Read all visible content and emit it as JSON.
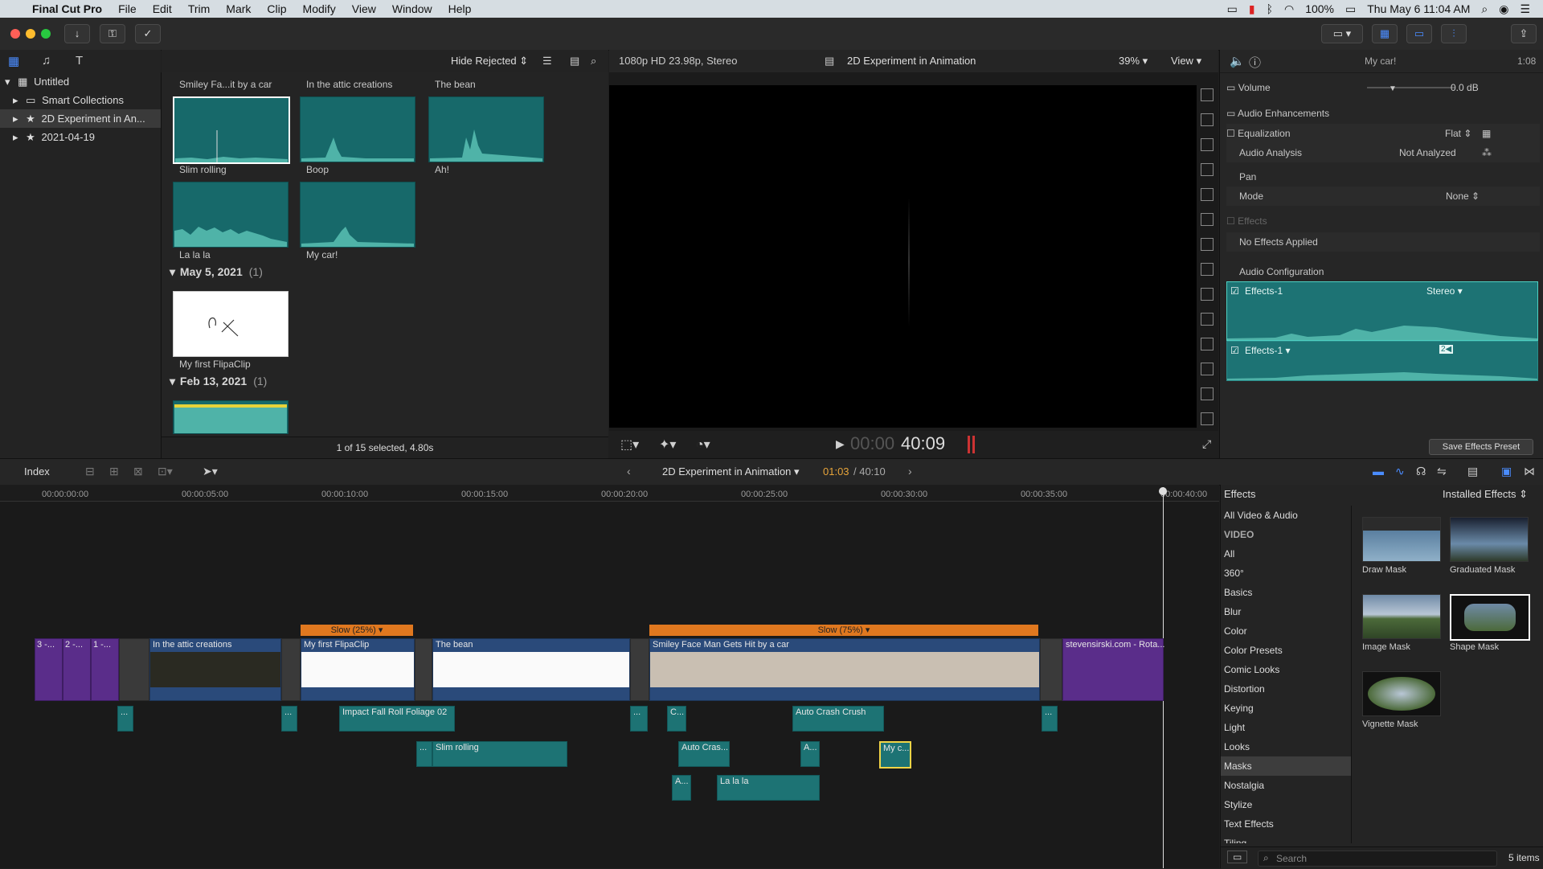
{
  "menubar": {
    "app_name": "Final Cut Pro",
    "items": [
      "File",
      "Edit",
      "Trim",
      "Mark",
      "Clip",
      "Modify",
      "View",
      "Window",
      "Help"
    ],
    "battery": "100%",
    "clock": "Thu May 6  11:04 AM"
  },
  "library": {
    "root": "Untitled",
    "items": [
      "Smart Collections",
      "2D Experiment in An...",
      "2021-04-19"
    ]
  },
  "browser": {
    "filter_label": "Hide Rejected",
    "top_labels": [
      "Smiley Fa...it by a car",
      "In the attic creations",
      "The bean"
    ],
    "clips_row1": [
      "Slim rolling",
      "Boop",
      "Ah!"
    ],
    "clips_row2": [
      "La la la",
      "My car!"
    ],
    "date_group1": {
      "date": "May 5, 2021",
      "count": "(1)"
    },
    "clip_flipaclip": "My first FlipaClip",
    "date_group2": {
      "date": "Feb 13, 2021",
      "count": "(1)"
    },
    "status": "1 of 15 selected, 4.80s"
  },
  "viewer": {
    "format": "1080p HD 23.98p, Stereo",
    "project_name": "2D Experiment in Animation",
    "zoom": "39%",
    "view_label": "View",
    "timecode_dim": "00:00",
    "timecode": "40:09"
  },
  "inspector": {
    "clip_name": "My car!",
    "duration": "1:08",
    "volume_label": "Volume",
    "volume_value": "0.0 dB",
    "audio_enhancements": "Audio Enhancements",
    "equalization_label": "Equalization",
    "equalization_value": "Flat",
    "audio_analysis_label": "Audio Analysis",
    "audio_analysis_value": "Not Analyzed",
    "pan_label": "Pan",
    "mode_label": "Mode",
    "mode_value": "None",
    "effects_label": "Effects",
    "no_effects": "No Effects Applied",
    "audio_config": "Audio Configuration",
    "channel1_name": "Effects-1",
    "channel1_mode": "Stereo",
    "channel2_name": "Effects-1",
    "save_preset": "Save Effects Preset"
  },
  "timeline_bar": {
    "index_label": "Index",
    "project_name": "2D Experiment in Animation",
    "position": "01:03",
    "total": "/ 40:10"
  },
  "ruler": [
    "00:00:00:00",
    "00:00:05:00",
    "00:00:10:00",
    "00:00:15:00",
    "00:00:20:00",
    "00:00:25:00",
    "00:00:30:00",
    "00:00:35:00",
    "00:00:40:00"
  ],
  "timeline": {
    "retime1": "Slow (25%)",
    "retime2": "Slow (75%)",
    "p1": "3 -...",
    "p2": "2 -...",
    "p3": "1 -...",
    "v_attic": "In the attic creations",
    "v_flipaclip": "My first FlipaClip",
    "v_bean": "The bean",
    "v_smiley": "Smiley Face Man Gets Hit by a car",
    "v_stevensirski": "stevensirski.com - Rota...",
    "a_impact": "Impact Fall Roll Foliage 02",
    "a_autocrash": "Auto Crash Crush",
    "a_slim": "Slim rolling",
    "a_autocras2": "Auto Cras...",
    "a_lalala": "La la la",
    "a_mycar": "My c...",
    "dots": "...",
    "a_c": "C...",
    "a_a": "A..."
  },
  "effects_browser": {
    "title": "Effects",
    "installed": "Installed Effects",
    "categories": [
      "All Video & Audio",
      "VIDEO",
      "All",
      "360°",
      "Basics",
      "Blur",
      "Color",
      "Color Presets",
      "Comic Looks",
      "Distortion",
      "Keying",
      "Light",
      "Looks",
      "Masks",
      "Nostalgia",
      "Stylize",
      "Text Effects",
      "Tiling"
    ],
    "selected_category": "Masks",
    "items": [
      "Draw Mask",
      "Graduated Mask",
      "Image Mask",
      "Shape Mask",
      "Vignette Mask"
    ],
    "search_placeholder": "Search",
    "count": "5 items"
  },
  "colors": {
    "audio_teal": "#1d7374",
    "video_blue": "#2a4a7a",
    "retime_orange": "#e0781f",
    "purple_clip": "#5a2d8a",
    "accent_blue": "#4a8cff"
  }
}
